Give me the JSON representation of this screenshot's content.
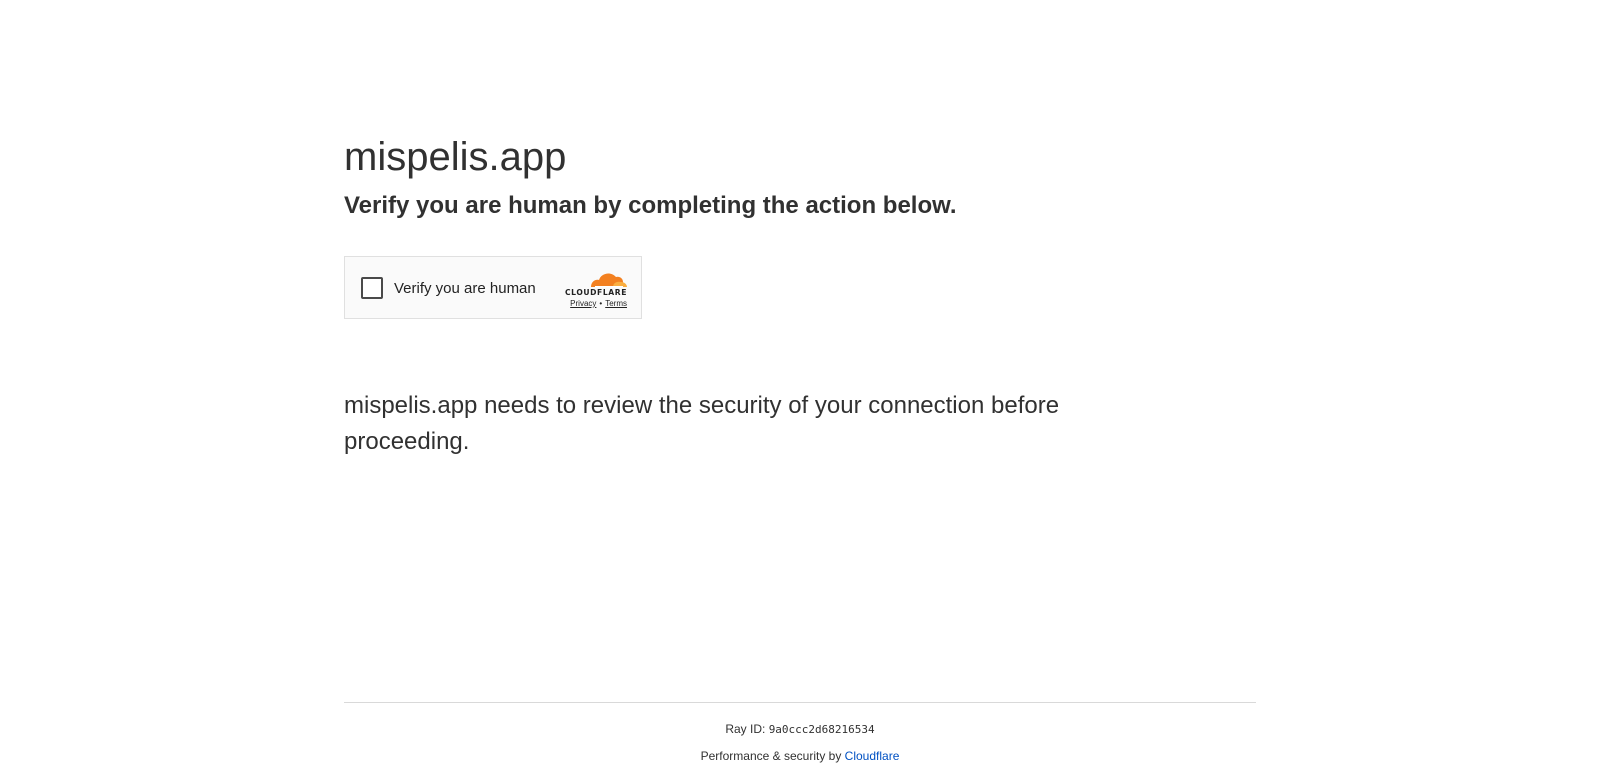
{
  "header": {
    "site_title": "mispelis.app",
    "subtitle": "Verify you are human by completing the action below."
  },
  "widget": {
    "checkbox_label": "Verify you are human",
    "checkbox_checked": false,
    "brand_icon": "cloudflare-logo",
    "brand_text": "CLOUDFLARE",
    "privacy_link": "Privacy",
    "link_separator": "•",
    "terms_link": "Terms",
    "colors": {
      "cloud_primary": "#f38020",
      "cloud_secondary": "#faae40",
      "background": "#fafafa",
      "border": "#e0e0e0"
    }
  },
  "main": {
    "security_message": "mispelis.app needs to review the security of your connection before proceeding."
  },
  "footer": {
    "ray_label": "Ray ID:",
    "ray_id": "9a0ccc2d68216534",
    "performance_text": "Performance & security by",
    "cloudflare_link": "Cloudflare",
    "link_color": "#0051c3"
  }
}
